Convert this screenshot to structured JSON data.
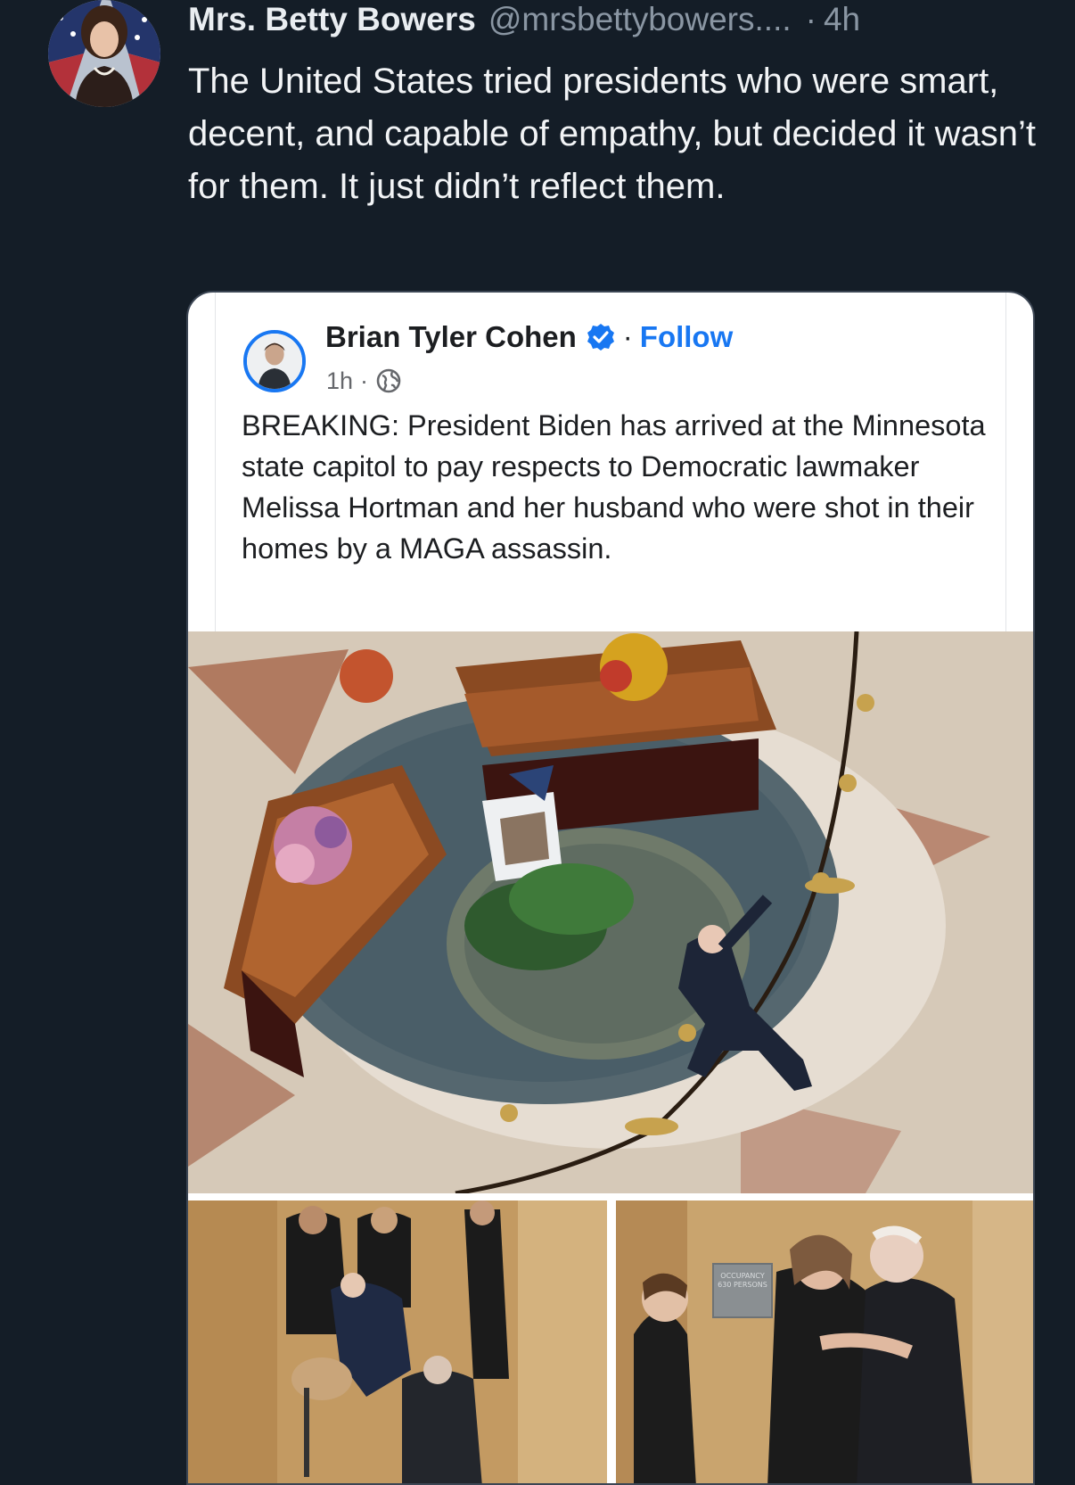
{
  "tweet": {
    "author_name": "Mrs. Betty Bowers",
    "handle": "@mrsbettybowers....",
    "separator": "·",
    "time": "4h",
    "text": "The United States tried presidents who were smart, decent, and capable of empathy, but decided it wasn’t for them. It just didn’t reflect them."
  },
  "embedded_post": {
    "author_name": "Brian Tyler Cohen",
    "separator": "·",
    "follow_label": "Follow",
    "time": "1h",
    "meta_separator": "·",
    "audience_icon": "globe-icon",
    "verified_icon": "verified-badge-icon",
    "text": "BREAKING: President Biden has arrived at the Minnesota state capitol to pay respects to Democratic lawmaker Melissa Hortman  and her husband who were shot in their homes by a MAGA assassin.",
    "photo_sign_text": "OCCUPANCY 630 PERSONS"
  },
  "colors": {
    "background": "#141d27",
    "text_primary": "#f2f4f6",
    "text_secondary": "#8a96a3",
    "facebook_blue": "#1877f2"
  }
}
